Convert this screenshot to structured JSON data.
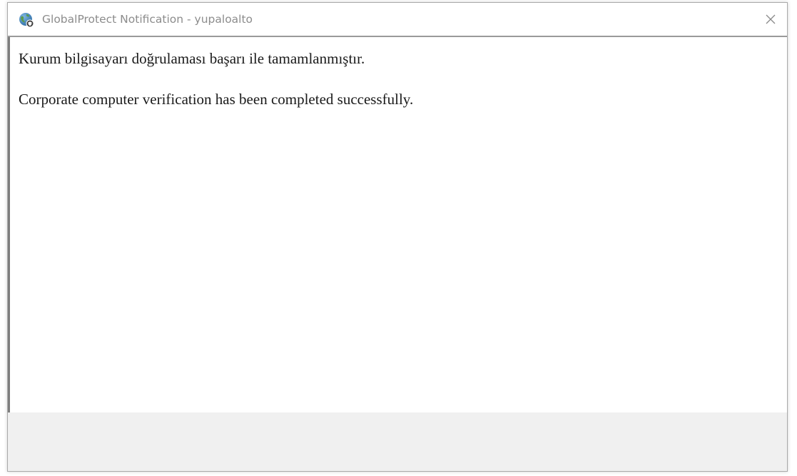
{
  "window": {
    "title": "GlobalProtect Notification - yupaloalto",
    "app_icon": "globalprotect-globe-icon",
    "close_icon": "close-icon"
  },
  "content": {
    "message_turkish": "Kurum bilgisayarı doğrulaması başarı ile tamamlanmıştır.",
    "message_english": "Corporate computer verification has been completed successfully."
  },
  "colors": {
    "title_text": "#8c8c8c",
    "body_text": "#1a1a1a",
    "footer_bg": "#f0f0f0",
    "border": "#9a9a9a"
  }
}
